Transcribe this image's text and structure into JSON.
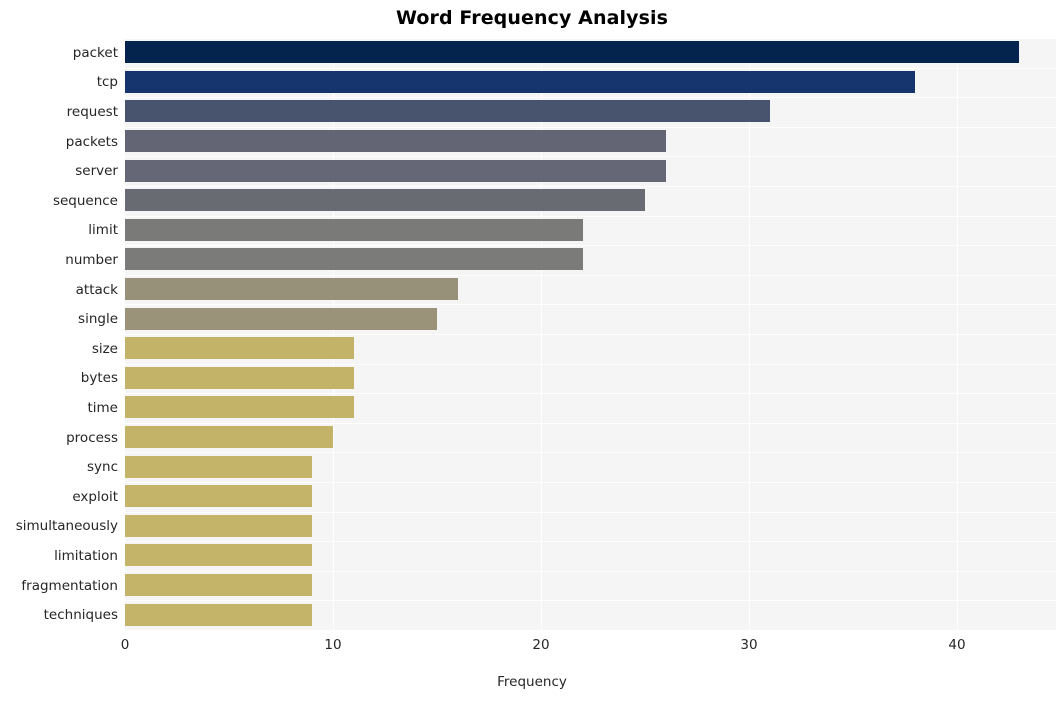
{
  "chart_data": {
    "type": "bar",
    "orientation": "horizontal",
    "title": "Word Frequency Analysis",
    "xlabel": "Frequency",
    "ylabel": "",
    "categories": [
      "packet",
      "tcp",
      "request",
      "packets",
      "server",
      "sequence",
      "limit",
      "number",
      "attack",
      "single",
      "size",
      "bytes",
      "time",
      "process",
      "sync",
      "exploit",
      "simultaneously",
      "limitation",
      "fragmentation",
      "techniques"
    ],
    "values": [
      43,
      38,
      31,
      26,
      26,
      25,
      22,
      22,
      16,
      15,
      11,
      11,
      11,
      10,
      9,
      9,
      9,
      9,
      9,
      9
    ],
    "colors": [
      "#04234d",
      "#16346e",
      "#48536e",
      "#636575",
      "#656776",
      "#696b73",
      "#7a7a78",
      "#7b7b79",
      "#97917a",
      "#9a9379",
      "#c2b369",
      "#c2b369",
      "#c2b369",
      "#c2b369",
      "#c3b46a",
      "#c3b46a",
      "#c3b46a",
      "#c3b46a",
      "#c3b46a",
      "#c3b46a"
    ],
    "xlim": [
      0,
      44.76
    ],
    "xticks": [
      0,
      10,
      20,
      30,
      40
    ],
    "xtick_labels": [
      "0",
      "10",
      "20",
      "30",
      "40"
    ],
    "grid": true,
    "grid_color": "#ffffff",
    "plot_background": "#f5f5f6",
    "figure_background": "#ffffff",
    "legend": null
  }
}
